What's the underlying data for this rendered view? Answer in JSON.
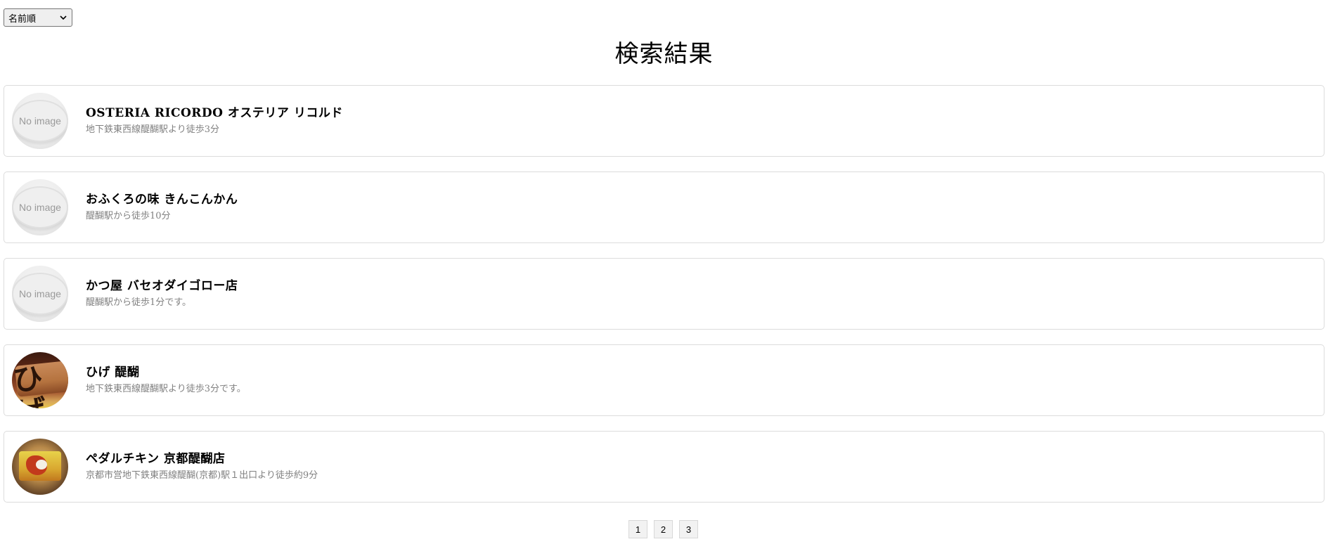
{
  "sort": {
    "selected": "名前順"
  },
  "page_title": "検索結果",
  "results": [
    {
      "name": "OSTERIA RICORDO オステリア リコルド",
      "access": "地下鉄東西線醍醐駅より徒歩3分",
      "thumbnail": "No image"
    },
    {
      "name": "おふくろの味 きんこんかん",
      "access": "醍醐駅から徒歩10分",
      "thumbnail": "No image"
    },
    {
      "name": "かつ屋 バセオダイゴロー店",
      "access": "醍醐駅から徒歩1分です。",
      "thumbnail": "No image"
    },
    {
      "name": "ひげ 醍醐",
      "access": "地下鉄東西線醍醐駅より徒歩3分です。",
      "thumbnail": "photo"
    },
    {
      "name": "ペダルチキン 京都醍醐店",
      "access": "京都市営地下鉄東西線醍醐(京都)駅１出口より徒歩約9分",
      "thumbnail": "photo"
    }
  ],
  "pagination": {
    "pages": [
      "1",
      "2",
      "3"
    ]
  },
  "icons": {
    "sort_chevron": "chevron-down-icon"
  }
}
